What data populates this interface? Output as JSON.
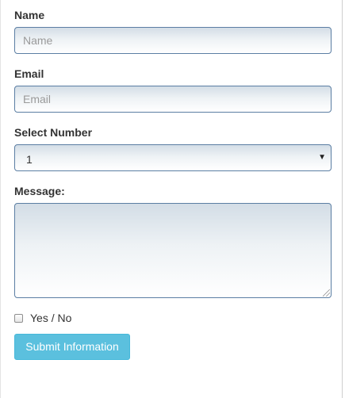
{
  "form": {
    "name": {
      "label": "Name",
      "placeholder": "Name",
      "value": ""
    },
    "email": {
      "label": "Email",
      "placeholder": "Email",
      "value": ""
    },
    "select_number": {
      "label": "Select Number",
      "selected": "1"
    },
    "message": {
      "label": "Message:",
      "value": ""
    },
    "checkbox": {
      "label": "Yes / No",
      "checked": false
    },
    "submit_label": "Submit Information"
  },
  "colors": {
    "field_border": "#5b7ea3",
    "button_bg": "#5bc0de",
    "label_text": "#333333"
  },
  "icons": {
    "select_arrow": "triangle-down-icon"
  }
}
